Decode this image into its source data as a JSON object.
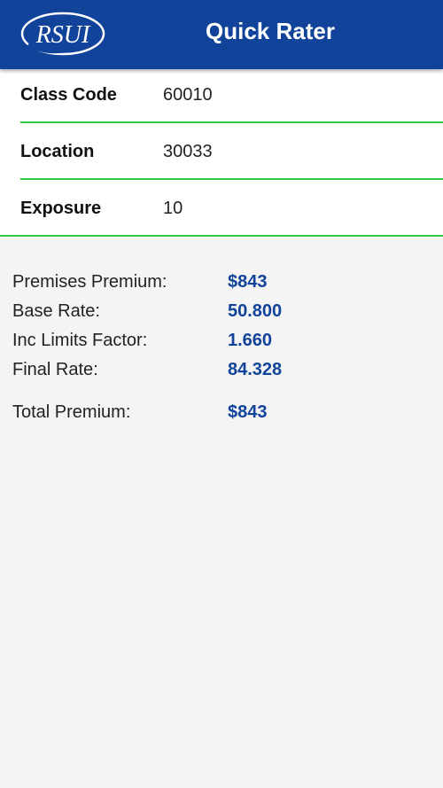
{
  "header": {
    "logo_text": "RSUI",
    "title": "Quick Rater",
    "brand_color": "#11439b"
  },
  "form": {
    "fields": [
      {
        "label": "Class Code",
        "value": "60010"
      },
      {
        "label": "Location",
        "value": "30033"
      },
      {
        "label": "Exposure",
        "value": "10"
      }
    ],
    "separator_color": "#2ecc40"
  },
  "results": {
    "rows": [
      {
        "label": "Premises Premium:",
        "value": "$843"
      },
      {
        "label": "Base Rate:",
        "value": "50.800"
      },
      {
        "label": "Inc Limits Factor:",
        "value": "1.660"
      },
      {
        "label": "Final Rate:",
        "value": "84.328"
      }
    ],
    "total": {
      "label": "Total Premium:",
      "value": "$843"
    },
    "value_color": "#11439b"
  }
}
